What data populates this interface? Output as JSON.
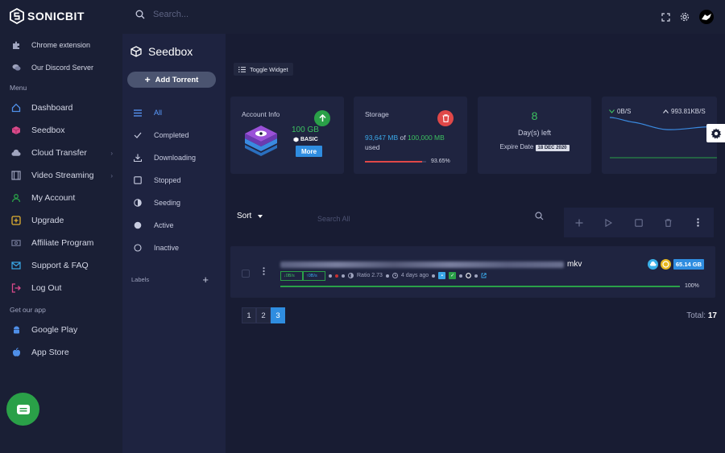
{
  "app": {
    "logo_text": "SONICBIT"
  },
  "search": {
    "placeholder": "Search..."
  },
  "sidebar": {
    "top_items": [
      {
        "label": "Chrome extension",
        "icon": "puzzle-icon"
      },
      {
        "label": "Our Discord Server",
        "icon": "chat-bubbles-icon"
      }
    ],
    "menu_title": "Menu",
    "menu_items": [
      {
        "label": "Dashboard",
        "icon": "home-icon"
      },
      {
        "label": "Seedbox",
        "icon": "cube-icon"
      },
      {
        "label": "Cloud Transfer",
        "icon": "cloud-icon",
        "chevron": "›"
      },
      {
        "label": "Video Streaming",
        "icon": "film-icon",
        "chevron": "›"
      },
      {
        "label": "My Account",
        "icon": "user-icon"
      },
      {
        "label": "Upgrade",
        "icon": "plus-box-icon"
      },
      {
        "label": "Affiliate Program",
        "icon": "money-icon"
      },
      {
        "label": "Support & FAQ",
        "icon": "mail-icon"
      },
      {
        "label": "Log Out",
        "icon": "logout-icon"
      }
    ],
    "app_title": "Get our app",
    "app_items": [
      {
        "label": "Google Play",
        "icon": "android-icon"
      },
      {
        "label": "App Store",
        "icon": "apple-icon"
      }
    ]
  },
  "seedbox": {
    "title": "Seedbox",
    "add_torrent": "Add Torrent",
    "filters": [
      "All",
      "Completed",
      "Downloading",
      "Stopped",
      "Seeding",
      "Active",
      "Inactive"
    ],
    "labels_title": "Labels",
    "labels_add": "+"
  },
  "main": {
    "toggle_widget": "Toggle Widget",
    "account": {
      "label": "Account Info",
      "size": "100 GB",
      "plan": "BASIC",
      "more": "More"
    },
    "storage": {
      "label": "Storage",
      "used": "93,647 MB",
      "of": "of",
      "total": "100,000 MB",
      "used_word": "used",
      "percent": "93.65%",
      "fill_fraction": 0.9365
    },
    "days": {
      "value": "8",
      "label": "Day(s) left",
      "expire_label": "Expire Date",
      "expire_date": "18 DEC 2020"
    },
    "speed": {
      "down": "0B/S",
      "up": "993.81KB/S"
    },
    "sort_label": "Sort",
    "search_all_placeholder": "Search All",
    "torrent": {
      "ext": "mkv",
      "down_speed": "↓0B/s",
      "up_speed": "↑0B/s",
      "ratio": "Ratio 2.73",
      "age": "4 days ago",
      "size": "65.14 GB",
      "progress": "100%",
      "progress_fraction": 1.0
    },
    "pages": [
      "1",
      "2",
      "3"
    ],
    "active_page": "3",
    "total_label": "Total:",
    "total_value": "17"
  },
  "colors": {
    "bg": "#1a1f35",
    "panel": "#1f2440",
    "accent_blue": "#2f8de0",
    "green": "#2aa048",
    "red": "#e04848",
    "active_filter": "#5c9cff"
  }
}
